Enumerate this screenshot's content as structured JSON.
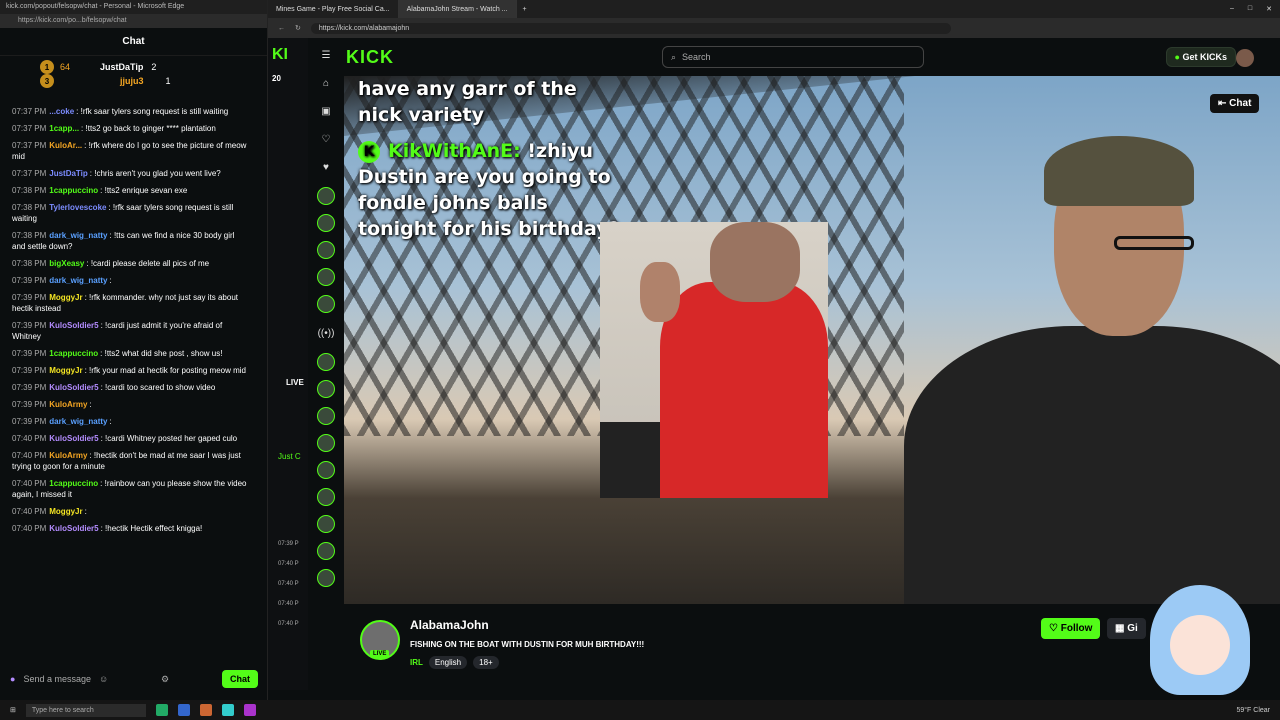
{
  "popout": {
    "window_title": "kick.com/popout/felsopw/chat - Personal - Microsoft Edge",
    "url": "https://kick.com/po...b/felsopw/chat",
    "header": "Chat",
    "leaders": [
      {
        "rank": "1",
        "name": "JustDaTip",
        "count": "2"
      },
      {
        "rank": "3",
        "name": "jjuju3",
        "count": "1"
      }
    ],
    "leader_partial": "64",
    "messages": [
      {
        "time": "07:37 PM",
        "user": "...coke",
        "color": "#7c8cff",
        "text": ": !rfk saar tylers song request is still waiting"
      },
      {
        "time": "07:37 PM",
        "user": "1capp...",
        "color": "#53fc18",
        "text": ": !tts2 go back to ginger **** plantation"
      },
      {
        "time": "07:37 PM",
        "user": "KuloAr...",
        "color": "#f5a623",
        "text": ": !rfk where do I go to see the picture of meow mid"
      },
      {
        "time": "07:37 PM",
        "user": "JustDaTip",
        "color": "#7c8cff",
        "text": ": !chris aren't you glad you went live?"
      },
      {
        "time": "07:38 PM",
        "user": "1cappuccino",
        "color": "#53fc18",
        "text": ": !tts2 enrique sevan exe"
      },
      {
        "time": "07:38 PM",
        "user": "Tylerlovescoke",
        "color": "#7c8cff",
        "text": ": !rfk saar tylers song request is still waiting"
      },
      {
        "time": "07:38 PM",
        "user": "dark_wig_natty",
        "color": "#5aa0ff",
        "text": ": !tts can we find a nice 30 body girl and settle down?"
      },
      {
        "time": "07:38 PM",
        "user": "bigXeasy",
        "color": "#53fc18",
        "text": ": !cardi please delete all pics of me"
      },
      {
        "time": "07:39 PM",
        "user": "dark_wig_natty",
        "color": "#5aa0ff",
        "text": ":"
      },
      {
        "time": "07:39 PM",
        "user": "MoggyJr",
        "color": "#f5e623",
        "text": ": !rfk kommander. why not just say its about hectik instead"
      },
      {
        "time": "07:39 PM",
        "user": "KuloSoldier5",
        "color": "#b48cff",
        "text": ": !cardi just admit it you're afraid of Whitney"
      },
      {
        "time": "07:39 PM",
        "user": "1cappuccino",
        "color": "#53fc18",
        "text": ": !tts2 what did she post , show us!"
      },
      {
        "time": "07:39 PM",
        "user": "MoggyJr",
        "color": "#f5e623",
        "text": ": !rfk your mad at hectik for posting meow mid"
      },
      {
        "time": "07:39 PM",
        "user": "KuloSoldier5",
        "color": "#b48cff",
        "text": ": !cardi too scared to show video"
      },
      {
        "time": "07:39 PM",
        "user": "KuloArmy",
        "color": "#f5a623",
        "text": ":"
      },
      {
        "time": "07:39 PM",
        "user": "dark_wig_natty",
        "color": "#5aa0ff",
        "text": ":"
      },
      {
        "time": "07:40 PM",
        "user": "KuloSoldier5",
        "color": "#b48cff",
        "text": ": !cardi Whitney posted her gaped culo"
      },
      {
        "time": "07:40 PM",
        "user": "KuloArmy",
        "color": "#f5a623",
        "text": ": !hectik don't be mad at me saar I was just trying to goon for a minute"
      },
      {
        "time": "07:40 PM",
        "user": "1cappuccino",
        "color": "#53fc18",
        "text": ": !rainbow can you please show the video again, I missed it"
      },
      {
        "time": "07:40 PM",
        "user": "MoggyJr",
        "color": "#f5e623",
        "text": ":"
      },
      {
        "time": "07:40 PM",
        "user": "KuloSoldier5",
        "color": "#b48cff",
        "text": ": !hectik Hectik effect knigga!"
      }
    ],
    "input_placeholder": "Send a message",
    "chat_button": "Chat"
  },
  "browser": {
    "tabs": [
      {
        "label": "Mines Game - Play Free Social Ca..."
      },
      {
        "label": "AlabamaJohn Stream - Watch ..."
      }
    ],
    "url": "https://kick.com/alabamajohn"
  },
  "kick": {
    "logo": "KICK",
    "search_placeholder": "Search",
    "get_kicks": "Get KICKs",
    "left_rail_count": "20",
    "left_rail_live": "LIVE",
    "left_rail_name": "Just C",
    "left_rail_times": [
      "07:39 P",
      "07:40 P",
      "07:40 P",
      "07:40 P",
      "07:40 P"
    ],
    "chat_toggle": "Chat",
    "nav_icons": [
      "home-icon",
      "browse-icon",
      "following-icon"
    ]
  },
  "video": {
    "overlay_line1": "have any garr of the nick variety",
    "overlay_user": "KikWithAnE:",
    "overlay_cmd": "!zhiyu",
    "overlay_msg": "Dustin are you going to fondle johns balls tonight for his birthday?"
  },
  "channel": {
    "name": "AlabamaJohn",
    "title": "FISHING ON THE BOAT WITH DUSTIN FOR MUH BIRTHDAY!!!",
    "category": "IRL",
    "tags": [
      "English",
      "18+"
    ],
    "live": "LIVE",
    "follow": "Follow",
    "gift": "Gi"
  },
  "taskbar": {
    "search": "Type here to search",
    "weather": "59°F Clear"
  },
  "colors": {
    "accent": "#53fc18",
    "background": "#0b0e0f"
  }
}
